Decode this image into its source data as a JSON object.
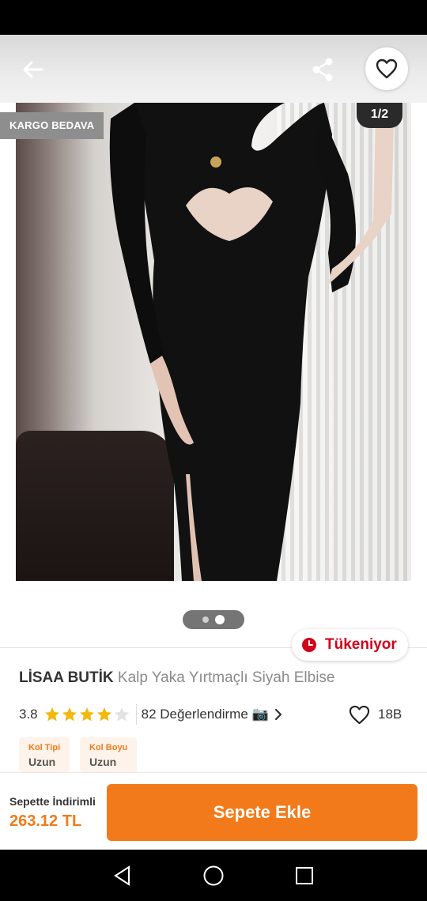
{
  "header": {
    "back_icon": "arrow-left-icon",
    "share_icon": "share-icon",
    "favorite_icon": "heart-outline-icon"
  },
  "gallery": {
    "badge": "KARGO BEDAVA",
    "page_indicator": "1/2",
    "current_page": 1,
    "total_pages": 2
  },
  "stock_badge": {
    "text": "Tükeniyor",
    "icon": "clock-icon",
    "color": "#d0021b"
  },
  "product": {
    "brand": "LİSAA BUTİK",
    "name": "Kalp Yaka Yırtmaçlı Siyah Elbise",
    "rating": "3.8",
    "rating_value": 3.8,
    "stars_max": 5,
    "reviews": "82 Değerlendirme 📷",
    "likes": "18B"
  },
  "attributes": [
    {
      "label": "Kol Tipi",
      "value": "Uzun"
    },
    {
      "label": "Kol Boyu",
      "value": "Uzun"
    }
  ],
  "bottom_bar": {
    "discount_label": "Sepette İndirimli",
    "price": "263.12 TL",
    "add_to_cart": "Sepete Ekle",
    "accent_color": "#f27a1a"
  },
  "system_nav": {
    "back": "nav-back-icon",
    "home": "nav-home-icon",
    "recents": "nav-recents-icon"
  }
}
